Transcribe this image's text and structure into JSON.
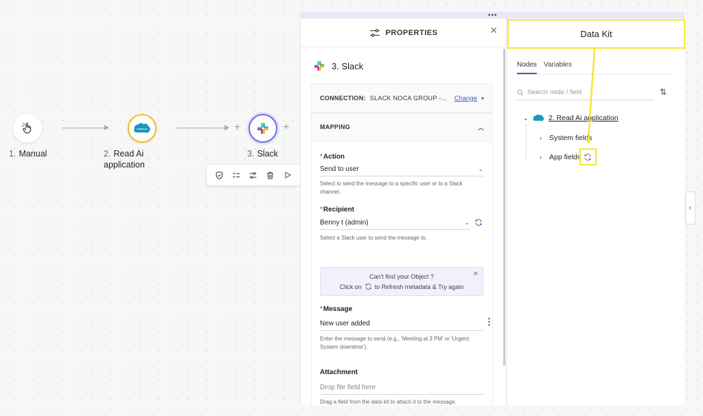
{
  "workflow": {
    "nodes": [
      {
        "num": "1.",
        "label": "Manual",
        "icon": "hand-pointer-icon"
      },
      {
        "num": "2.",
        "label": "Read Ai application",
        "icon": "salesforce-icon"
      },
      {
        "num": "3.",
        "label": "Slack",
        "icon": "slack-icon"
      }
    ],
    "toolbar_icons": [
      "shield-check-icon",
      "checklist-icon",
      "sliders-icon",
      "trash-icon",
      "play-icon"
    ]
  },
  "properties": {
    "header_title": "PROPERTIES",
    "close_icon": "close-icon",
    "step_title": "3. Slack",
    "connection_label": "CONNECTION:",
    "connection_value": "SLACK NOCA GROUP -...",
    "change_label": "Change",
    "mapping_label": "MAPPING",
    "action": {
      "label": "Action",
      "value": "Send to user",
      "help": "Select to send the message to a specific user or to a Slack channel."
    },
    "recipient": {
      "label": "Recipient",
      "value": "Benny t (admin)",
      "help": "Select a Slack user to send the message to."
    },
    "info": {
      "line1": "Can't find your Object ?",
      "line2_prefix": "Click on",
      "line2_suffix": "to Refresh metadata & Try again"
    },
    "message": {
      "label": "Message",
      "value": "New user added",
      "help": "Enter the message to send (e.g., 'Meeting at 3 PM' or 'Urgent: System downtime')."
    },
    "attachment": {
      "label": "Attachment",
      "placeholder": "Drop file field here",
      "help": "Drag a field from the data kit to attach it to the message."
    }
  },
  "datakit": {
    "title": "Data Kit",
    "tabs": [
      "Nodes",
      "Variables"
    ],
    "active_tab": "Nodes",
    "search_placeholder": "Search node / field",
    "tree": {
      "root_label": "2. Read Ai application",
      "children": [
        "System fields",
        "App fields"
      ]
    }
  },
  "colors": {
    "accent": "#4a55c9",
    "highlight": "#f2e63a",
    "salesforce": "#1798c1"
  }
}
